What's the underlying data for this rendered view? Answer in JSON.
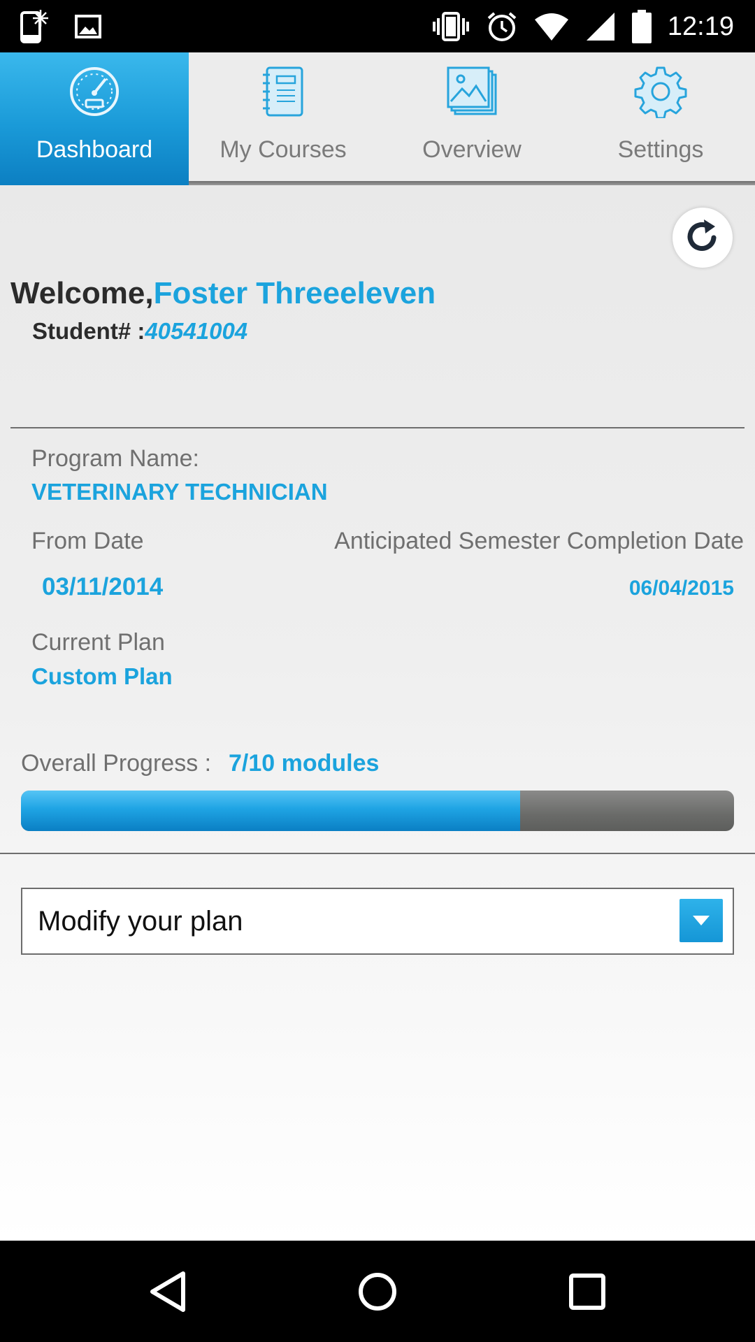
{
  "status_bar": {
    "time": "12:19",
    "icons": [
      "notification-icon",
      "image-icon",
      "vibrate-icon",
      "alarm-icon",
      "wifi-icon",
      "signal-icon",
      "battery-icon"
    ]
  },
  "tabs": [
    {
      "label": "Dashboard",
      "icon": "speedometer-icon",
      "active": true
    },
    {
      "label": "My Courses",
      "icon": "notebook-icon",
      "active": false
    },
    {
      "label": "Overview",
      "icon": "gallery-icon",
      "active": false
    },
    {
      "label": "Settings",
      "icon": "gear-icon",
      "active": false
    }
  ],
  "welcome": {
    "prefix": "Welcome,",
    "name": "Foster Threeeleven",
    "student_label": "Student# :",
    "student_number": "40541004"
  },
  "program": {
    "name_label": "Program Name:",
    "name_value": "VETERINARY TECHNICIAN",
    "from_label": "From Date",
    "from_value": "03/11/2014",
    "completion_label": "Anticipated Semester Completion Date",
    "completion_value": "06/04/2015",
    "plan_label": "Current Plan",
    "plan_value": "Custom Plan"
  },
  "progress": {
    "label": "Overall Progress :",
    "value_text": "7/10 modules",
    "fraction": 0.7
  },
  "plan_select": {
    "selected": "Modify your plan"
  },
  "colors": {
    "accent": "#1ba3dd",
    "tab_active": "#1a9ad8"
  }
}
